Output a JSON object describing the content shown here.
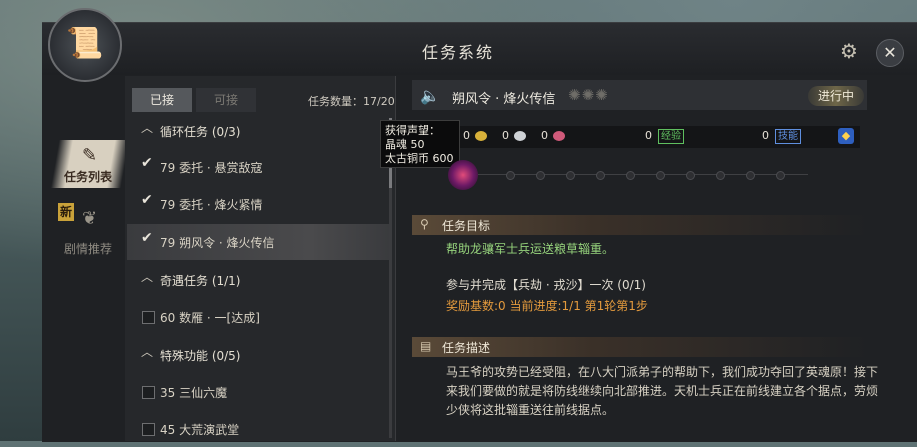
{
  "window": {
    "title": "任务系统"
  },
  "nav": {
    "items": [
      {
        "label": "任务列表",
        "active": true
      },
      {
        "label": "剧情推荐",
        "badge": "新",
        "active": false
      }
    ]
  },
  "list": {
    "tabs": [
      "已接",
      "可接"
    ],
    "count_label": "任务数量：17/20",
    "groups": [
      {
        "title": "循环任务 (0/3)",
        "tasks": [
          {
            "label": "79 委托 · 悬赏敌寇",
            "checked": true
          },
          {
            "label": "79 委托 · 烽火紧情",
            "checked": true
          },
          {
            "label": "79 朔风令 · 烽火传信",
            "checked": true,
            "selected": true
          }
        ]
      },
      {
        "title": "奇遇任务 (1/1)",
        "tasks": [
          {
            "label": "60 数雁 · 一[达成]",
            "checked": false
          }
        ]
      },
      {
        "title": "特殊功能 (0/5)",
        "tasks": [
          {
            "label": "35 三仙六魔",
            "checked": false
          },
          {
            "label": "45 大荒演武堂",
            "checked": false
          }
        ]
      }
    ]
  },
  "detail": {
    "task_name": "朔风令 · 烽火传信",
    "status": "进行中",
    "rewards": {
      "a": "0",
      "b": "0",
      "c": "0",
      "d": "0",
      "e": "0",
      "tag1": "经验",
      "tag2": "技能"
    },
    "tooltip": {
      "line1": "获得声望：",
      "line2": "晶魂  50",
      "line3": "太古铜币  600"
    },
    "goal_title": "任务目标",
    "goal_text": "帮助龙骧军士兵运送粮草辎重。",
    "goal_sub": "参与并完成【兵劫 · 戎沙】一次 (0/1)",
    "goal_progress": "奖励基数:0   当前进度:1/1  第1轮第1步",
    "desc_title": "任务描述",
    "desc_text": "马王爷的攻势已经受阻，在八大门派弟子的帮助下，我们成功夺回了英魂原！接下来我们要做的就是将防线继续向北部推进。天机士兵正在前线建立各个据点，劳烦少侠将这批辎重送往前线据点。"
  },
  "colors": {
    "goal": "#96d37c",
    "progress": "#e39a3d",
    "tag1": "#5fbf5f",
    "tag2": "#5f8fdf"
  }
}
